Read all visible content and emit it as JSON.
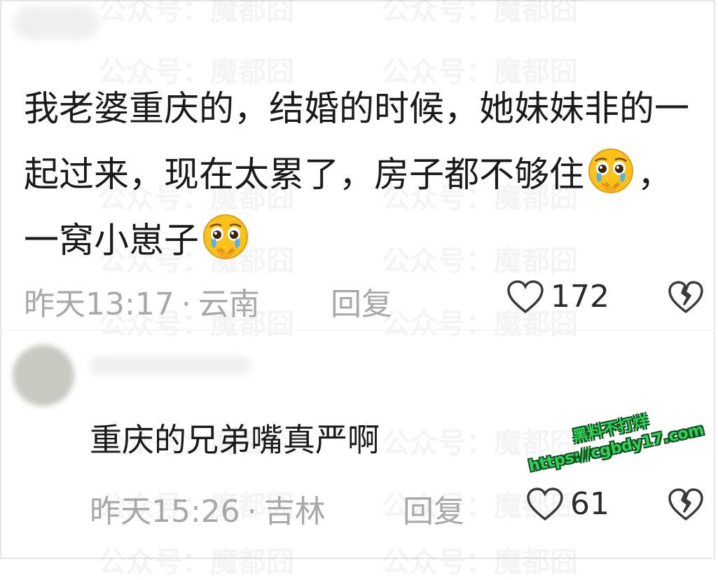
{
  "watermark": "公众号：魔都囧",
  "comments": [
    {
      "body_parts": [
        "我老婆重庆的，结婚的时候，她妹妹非的一起过来，现在太累了，房子都不够住",
        "，一窝小崽子"
      ],
      "emoji": "pleading-crying-face",
      "time": "昨天13:17",
      "dot": "·",
      "location": "云南",
      "reply_label": "回复",
      "likes": "172"
    },
    {
      "body": "重庆的兄弟嘴真严啊",
      "time": "昨天15:26",
      "dot": "·",
      "location": "吉林",
      "reply_label": "回复",
      "likes": "61"
    }
  ],
  "promo": {
    "line1": "黑料不打烊",
    "line2": "https://cgbdy17.com",
    "color": "#2fd35a"
  },
  "colors": {
    "meta_gray": "#a8a8a8",
    "text": "#1a1a1a"
  }
}
